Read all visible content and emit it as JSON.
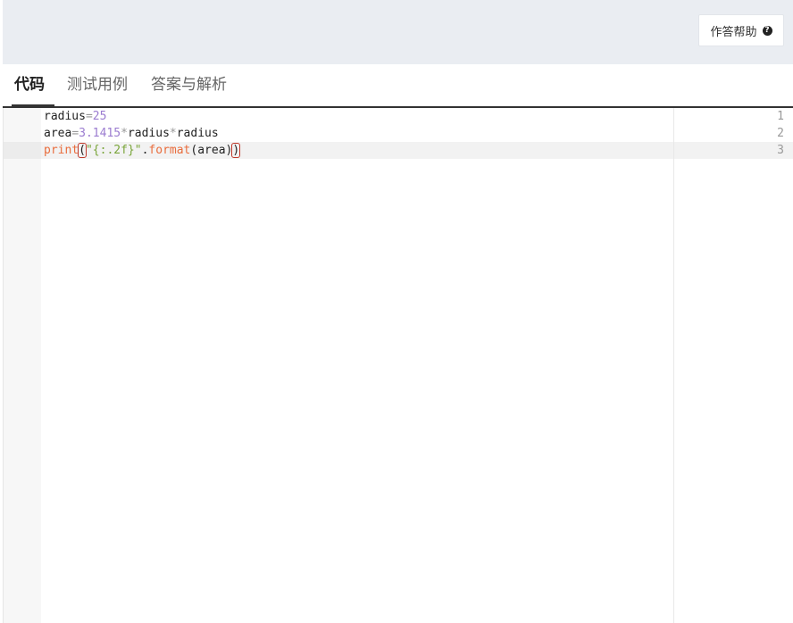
{
  "header": {
    "help_label": "作答帮助",
    "help_icon": "question-circle-icon"
  },
  "tabs": [
    {
      "label": "代码",
      "active": true
    },
    {
      "label": "测试用例",
      "active": false
    },
    {
      "label": "答案与解析",
      "active": false
    }
  ],
  "editor": {
    "line_numbers": [
      "1",
      "2",
      "3"
    ],
    "active_line": 3,
    "lines": [
      {
        "parts": [
          {
            "text": "radius",
            "kind": "ident"
          },
          {
            "text": "=",
            "kind": "operator"
          },
          {
            "text": "25",
            "kind": "number"
          }
        ]
      },
      {
        "parts": [
          {
            "text": "area",
            "kind": "ident"
          },
          {
            "text": "=",
            "kind": "operator"
          },
          {
            "text": "3.1415",
            "kind": "number"
          },
          {
            "text": "*",
            "kind": "operator"
          },
          {
            "text": "radius",
            "kind": "ident"
          },
          {
            "text": "*",
            "kind": "operator"
          },
          {
            "text": "radius",
            "kind": "ident"
          }
        ]
      },
      {
        "parts": [
          {
            "text": "print",
            "kind": "function"
          },
          {
            "text": "(",
            "kind": "paren-match"
          },
          {
            "text": "\"{:.2f}\"",
            "kind": "string"
          },
          {
            "text": ".",
            "kind": "ident"
          },
          {
            "text": "format",
            "kind": "function"
          },
          {
            "text": "(",
            "kind": "ident"
          },
          {
            "text": "area",
            "kind": "ident"
          },
          {
            "text": ")",
            "kind": "ident"
          },
          {
            "text": ")",
            "kind": "paren-match"
          }
        ]
      }
    ]
  },
  "colors": {
    "topbar_bg": "#eaedf2",
    "number": "#9b7cd0",
    "function": "#e96d3d",
    "string": "#7aa53a",
    "operator": "#999999",
    "bracket_highlight": "#c0392b"
  }
}
